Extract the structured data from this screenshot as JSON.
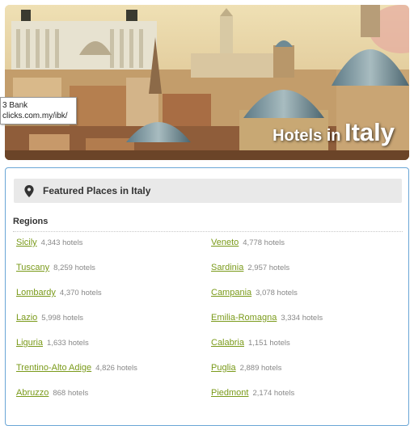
{
  "hero": {
    "title_prefix": "Hotels in",
    "title_country": "Italy"
  },
  "tooltip": {
    "line1": "3 Bank",
    "line2": "clicks.com.my/ibk/"
  },
  "featured": {
    "header": "Featured Places in Italy",
    "regions_heading": "Regions",
    "left": [
      {
        "name": "Sicily",
        "count": "4,343 hotels"
      },
      {
        "name": "Tuscany",
        "count": "8,259 hotels"
      },
      {
        "name": "Lombardy",
        "count": "4,370 hotels"
      },
      {
        "name": "Lazio",
        "count": "5,998 hotels"
      },
      {
        "name": "Liguria",
        "count": "1,633 hotels"
      },
      {
        "name": "Trentino-Alto Adige",
        "count": "4,826 hotels"
      },
      {
        "name": "Abruzzo",
        "count": "868 hotels"
      }
    ],
    "right": [
      {
        "name": "Veneto",
        "count": "4,778 hotels"
      },
      {
        "name": "Sardinia",
        "count": "2,957 hotels"
      },
      {
        "name": "Campania",
        "count": "3,078 hotels"
      },
      {
        "name": "Emilia-Romagna",
        "count": "3,334 hotels"
      },
      {
        "name": "Calabria",
        "count": "1,151 hotels"
      },
      {
        "name": "Puglia",
        "count": "2,889 hotels"
      },
      {
        "name": "Piedmont",
        "count": "2,174 hotels"
      }
    ]
  },
  "colors": {
    "link": "#7a9a1a",
    "panel_border": "#6aa6d6",
    "header_bg": "#e9e9e9"
  },
  "icons": {
    "header": "map-pin-icon"
  }
}
